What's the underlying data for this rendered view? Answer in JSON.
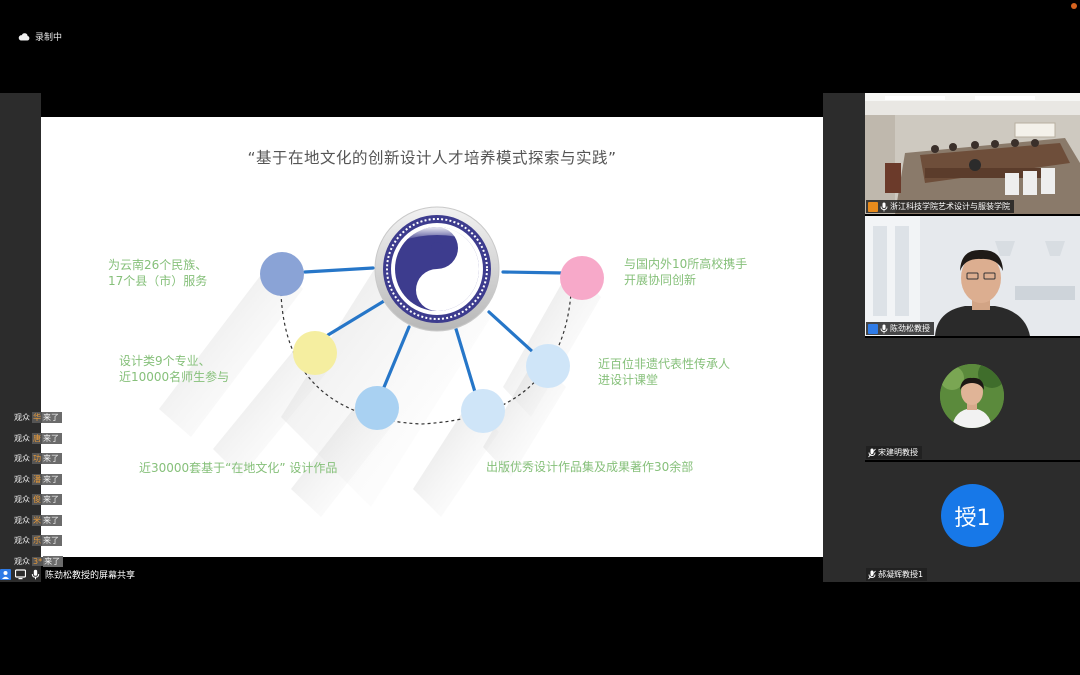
{
  "recording": {
    "label": "录制中"
  },
  "slide": {
    "title": "“基于在地文化的创新设计人才培养模式探索与实践”",
    "items": [
      {
        "lines": [
          "为云南26个民族、",
          "17个县（市）服务"
        ]
      },
      {
        "lines": [
          "设计类9个专业、",
          "近10000名师生参与"
        ]
      },
      {
        "lines": [
          "近30000套基于“在地文化” 设计作品"
        ]
      },
      {
        "lines": [
          "出版优秀设计作品集及成果著作30余部"
        ]
      },
      {
        "lines": [
          "近百位非遗代表性传承人",
          "进设计课堂"
        ]
      },
      {
        "lines": [
          "与国内外10所高校携手",
          "开展协同创新"
        ]
      }
    ],
    "colors": {
      "text_green": "#86c07a",
      "circle_blue_dark": "#8aa3d6",
      "circle_yellow": "#f5eea0",
      "circle_blue_light": "#a9d1f2",
      "circle_pink": "#f7a9c9",
      "line_blue": "#2676c8"
    }
  },
  "share_bar": {
    "label": "陈劲松教授的屏幕共享"
  },
  "chat": [
    {
      "who": "观众",
      "name": "华",
      "action": "来了"
    },
    {
      "who": "观众",
      "name": "唐",
      "action": "来了"
    },
    {
      "who": "观众",
      "name": "功",
      "action": "来了"
    },
    {
      "who": "观众",
      "name": "潘",
      "action": "来了"
    },
    {
      "who": "观众",
      "name": "俊",
      "action": "来了"
    },
    {
      "who": "观众",
      "name": "米",
      "action": "来了"
    },
    {
      "who": "观众",
      "name": "乐",
      "action": "来了"
    },
    {
      "who": "观众",
      "name": "3*",
      "action": "来了"
    }
  ],
  "participants": [
    {
      "name": "浙江科技学院艺术设计与服装学院",
      "role": "host"
    },
    {
      "name": "陈劲松教授",
      "role": "user"
    },
    {
      "name": "宋建明教授",
      "role": "attendee"
    },
    {
      "name": "郝凝辉教授1",
      "role": "attendee",
      "avatar_text": "授1"
    }
  ]
}
